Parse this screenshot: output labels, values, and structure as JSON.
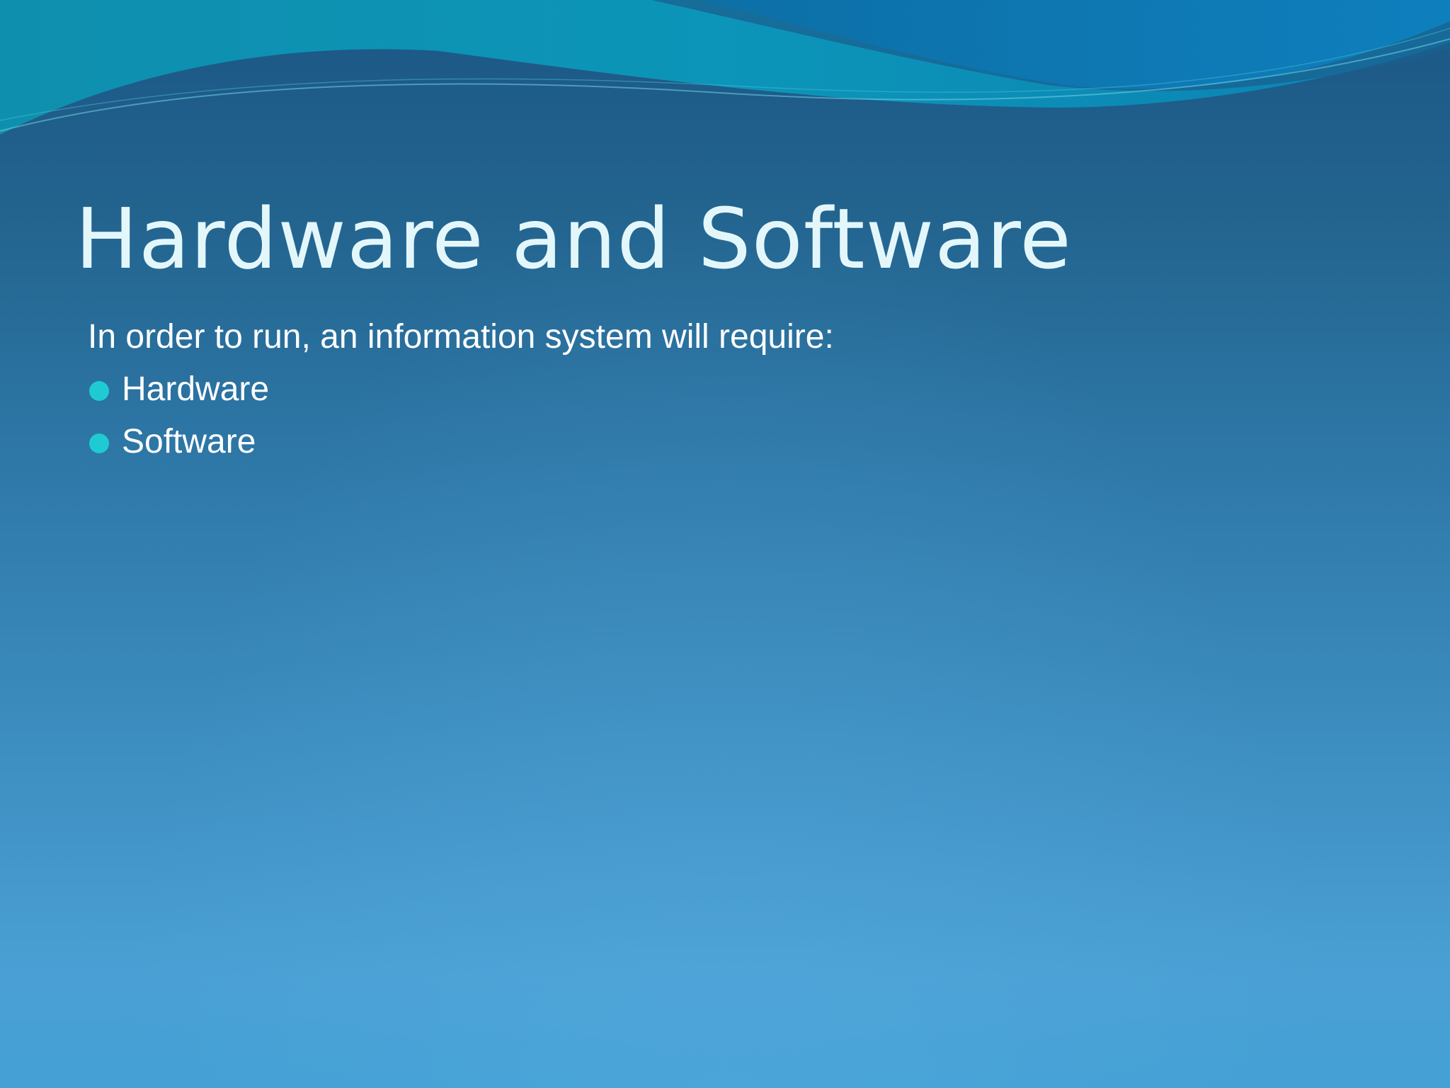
{
  "slide": {
    "title": "Hardware and Software",
    "intro": "In order to run, an information system will require:",
    "bullets": [
      {
        "label": "Hardware"
      },
      {
        "label": "Software"
      }
    ]
  },
  "colors": {
    "title_text": "#e3f7fb",
    "body_text": "#ffffff",
    "bullet": "#1ecbd3",
    "background_top": "#1b5685",
    "background_bottom": "#43a0d5",
    "wave_teal": "#1192b3",
    "wave_blue": "#0d78b5"
  },
  "icons": {
    "bullet": "filled-circle"
  }
}
